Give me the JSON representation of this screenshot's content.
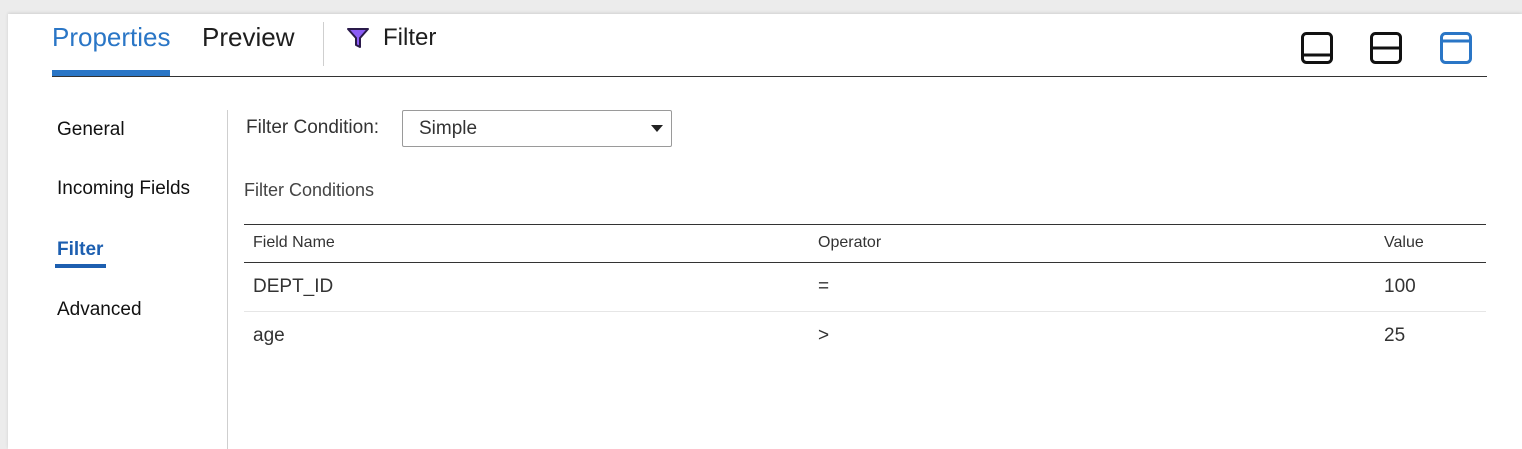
{
  "header": {
    "tabs": [
      {
        "label": "Properties",
        "active": true
      },
      {
        "label": "Preview",
        "active": false
      }
    ],
    "title": "Filter",
    "title_icon": "funnel-icon",
    "accent_color": "#2a76c6",
    "layout_buttons": [
      {
        "icon": "panel-bottom-icon",
        "active": false
      },
      {
        "icon": "panel-split-icon",
        "active": false
      },
      {
        "icon": "panel-top-icon",
        "active": true
      }
    ]
  },
  "sidebar": {
    "items": [
      {
        "label": "General",
        "active": false
      },
      {
        "label": "Incoming Fields",
        "active": false
      },
      {
        "label": "Filter",
        "active": true
      },
      {
        "label": "Advanced",
        "active": false
      }
    ]
  },
  "main": {
    "filter_condition_label": "Filter Condition:",
    "filter_condition_value": "Simple",
    "conditions_title": "Filter Conditions",
    "table": {
      "columns": [
        "Field Name",
        "Operator",
        "Value"
      ],
      "rows": [
        [
          "DEPT_ID",
          "=",
          "100"
        ],
        [
          "age",
          ">",
          "25"
        ]
      ]
    }
  }
}
